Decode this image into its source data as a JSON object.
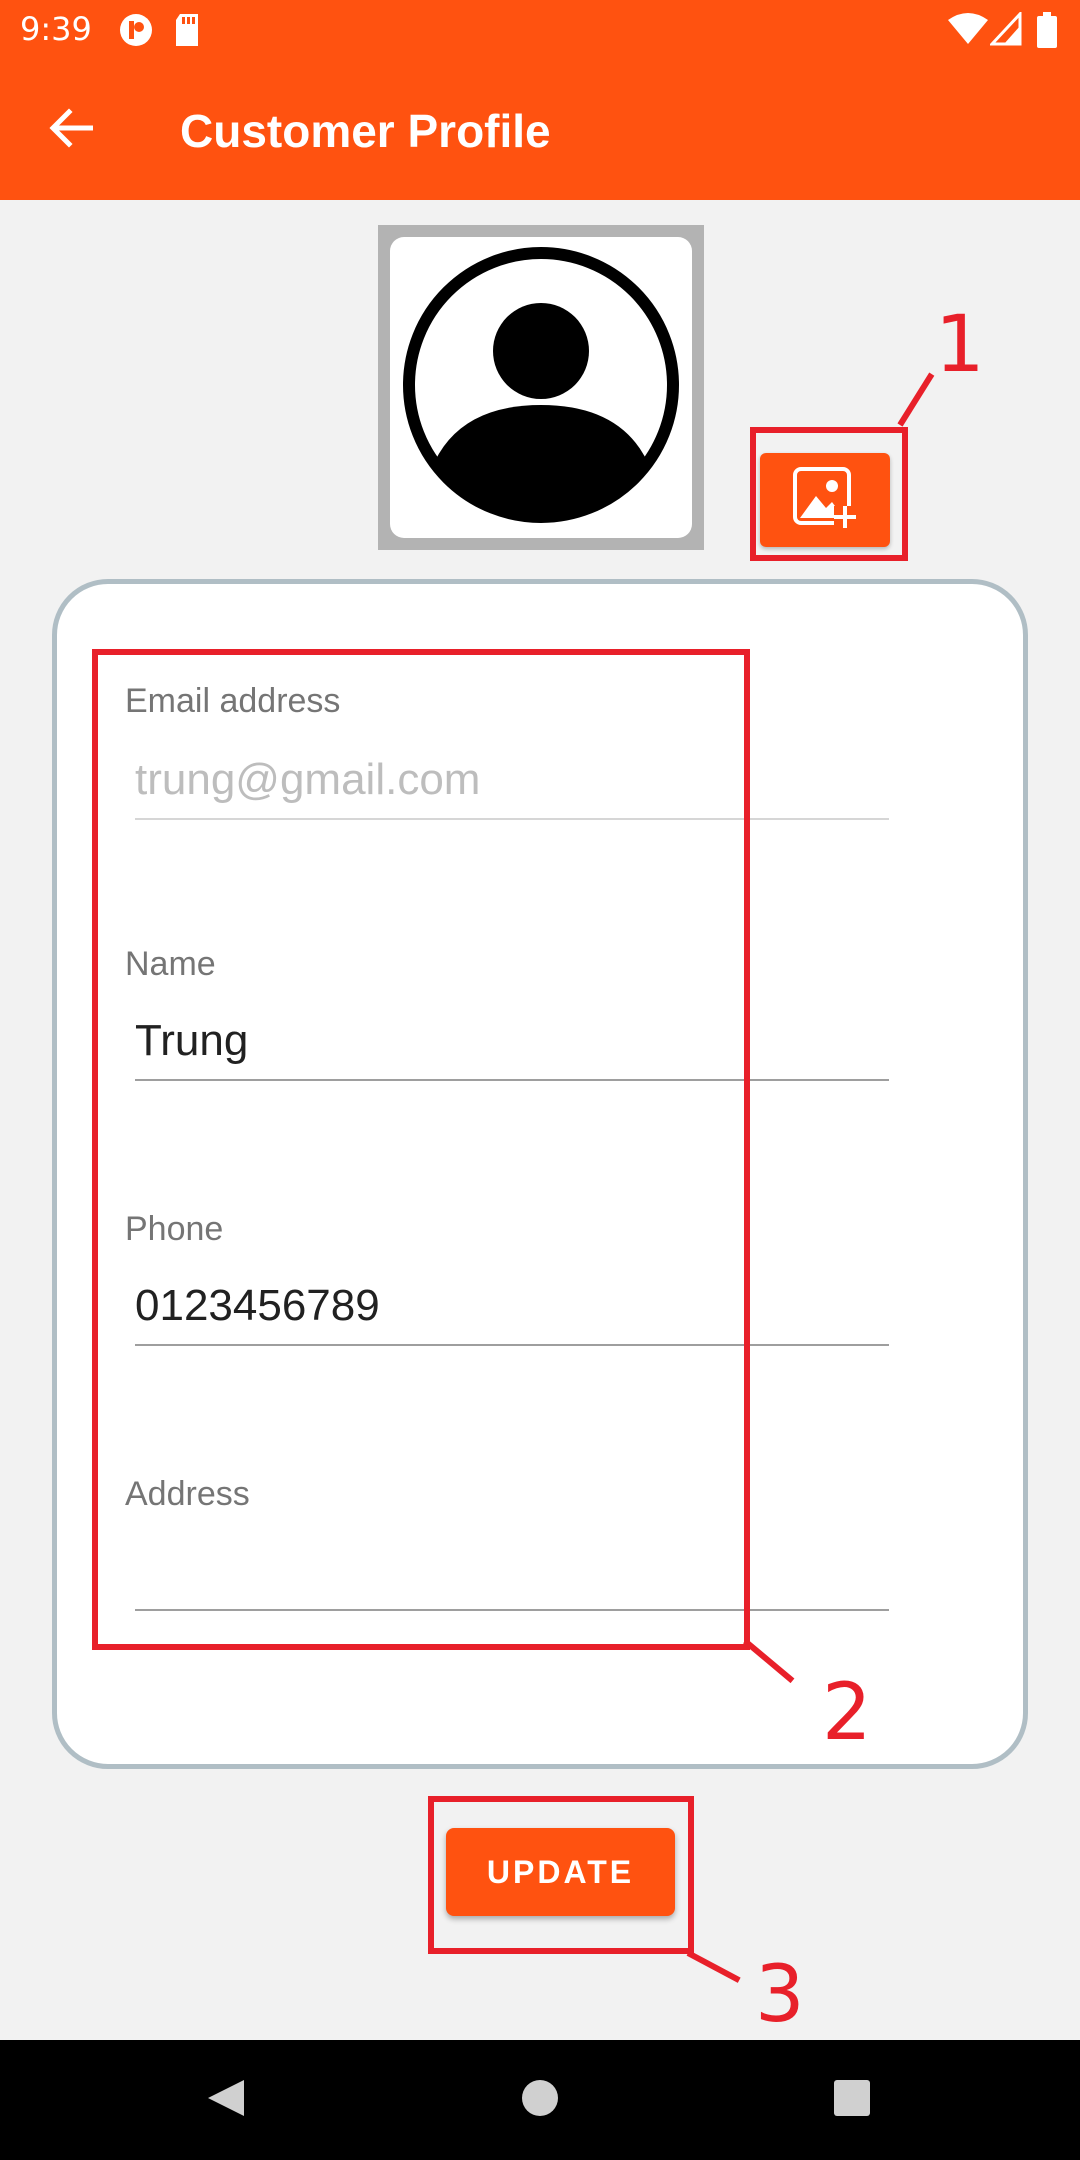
{
  "status_bar": {
    "time": "9:39",
    "icons": [
      "app-notification-icon",
      "sd-card-icon",
      "wifi-icon",
      "signal-icon",
      "battery-icon"
    ]
  },
  "app_bar": {
    "title": "Customer Profile",
    "back_icon": "arrow-left-icon"
  },
  "profile": {
    "avatar_icon": "user-avatar-icon",
    "add_photo_icon": "add-image-icon"
  },
  "form": {
    "email": {
      "label": "Email address",
      "value": "trung@gmail.com",
      "enabled": false
    },
    "name": {
      "label": "Name",
      "value": "Trung"
    },
    "phone": {
      "label": "Phone",
      "value": "0123456789"
    },
    "address": {
      "label": "Address",
      "value": ""
    }
  },
  "actions": {
    "update_label": "UPDATE"
  },
  "annotations": [
    "1",
    "2",
    "3"
  ],
  "colors": {
    "primary": "#ff5210",
    "annotation": "#e8202a",
    "card_border": "#b0bec5",
    "background": "#f2f2f2"
  }
}
